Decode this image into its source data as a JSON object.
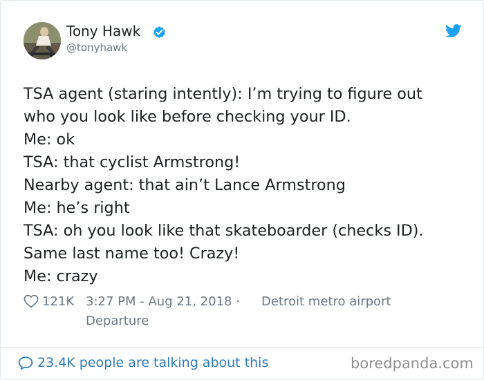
{
  "author": {
    "name": "Tony Hawk",
    "handle": "@tonyhawk",
    "avatar_icon": "skateboarder-photo"
  },
  "icons": {
    "verified": "verified-badge-icon",
    "brand": "twitter-bird-icon",
    "like": "heart-icon",
    "reply": "speech-bubble-icon"
  },
  "colors": {
    "text": "#1c2022",
    "muted": "#697882",
    "accent": "#1da1f2",
    "link": "#2b7bb9",
    "border": "#e1e8ed"
  },
  "tweet": {
    "lines": [
      "TSA agent (staring intently): I’m trying to figure out",
      "who you look like before checking your ID.",
      "Me: ok",
      "TSA: that cyclist Armstrong!",
      "Nearby agent: that ain’t Lance Armstrong",
      "Me: he’s right",
      "TSA: oh you look like that skateboarder (checks ID).",
      "Same last name too! Crazy!",
      "Me: crazy"
    ]
  },
  "meta": {
    "likes": "121K",
    "timestamp": "3:27 PM - Aug 21, 2018 ·",
    "location_line1": "Detroit metro airport",
    "location_line2": "Departure"
  },
  "footer": {
    "talking": "23.4K people are talking about this",
    "watermark": "boredpanda.com"
  }
}
